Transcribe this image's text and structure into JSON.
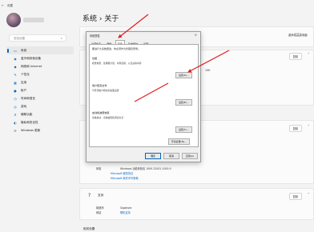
{
  "window": {
    "caption": "设置"
  },
  "page_title": "系统 › 关于",
  "search": {
    "placeholder": "查找设置"
  },
  "nav": [
    {
      "icon": "▭",
      "label": "系统"
    },
    {
      "icon": "◉",
      "label": "蓝牙和其他设备"
    },
    {
      "icon": "◆",
      "label": "网络和 Internet"
    },
    {
      "icon": "✎",
      "label": "个性化"
    },
    {
      "icon": "▦",
      "label": "应用"
    },
    {
      "icon": "●",
      "label": "帐户"
    },
    {
      "icon": "◷",
      "label": "时间和语言"
    },
    {
      "icon": "◎",
      "label": "游戏"
    },
    {
      "icon": "✗",
      "label": "辅助功能"
    },
    {
      "icon": "◐",
      "label": "隐私和安全性"
    },
    {
      "icon": "⟳",
      "label": "Windows 更新"
    }
  ],
  "top_right": {
    "rename_label": "重命名这台电脑"
  },
  "device_spec": {
    "copy_label": "复制",
    "partial_value": "19H"
  },
  "windows_spec": {
    "title": "Windows 规格",
    "copy_label": "复制",
    "rows": [
      {
        "key": "体验",
        "value": "Windows 功能体验包 1000.22001.1000.0"
      },
      {
        "key": "",
        "value": "Microsoft 服务协议"
      },
      {
        "key": "",
        "value": "Microsoft 软件许可条款"
      }
    ]
  },
  "support": {
    "title": "支持",
    "copy_label": "复制",
    "rows": [
      {
        "key": "制造商",
        "value": "Gigabyte"
      },
      {
        "key": "网站",
        "value": "联机支持"
      }
    ]
  },
  "related": {
    "title": "相关设置"
  },
  "dialog": {
    "title": "系统属性",
    "close": "×",
    "tabs": [
      "计算机名",
      "硬件",
      "高级",
      "系统保护",
      "远程"
    ],
    "active_tab": 2,
    "note": "要进行大多数更改，你必须作为管理员登录。",
    "groups": [
      {
        "title": "性能",
        "desc": "视觉效果，处理器计划，内存使用，以及虚拟内存",
        "button": "设置(S)..."
      },
      {
        "title": "用户配置文件",
        "desc": "与登录帐户相关的桌面设置",
        "button": "设置(E)..."
      },
      {
        "title": "启动和故障恢复",
        "desc": "系统启动、系统故障和调试信息",
        "button": "设置(T)..."
      }
    ],
    "env_button": "环境变量(N)...",
    "footer": {
      "ok": "确定",
      "cancel": "取消",
      "apply": "应用(A)"
    }
  }
}
